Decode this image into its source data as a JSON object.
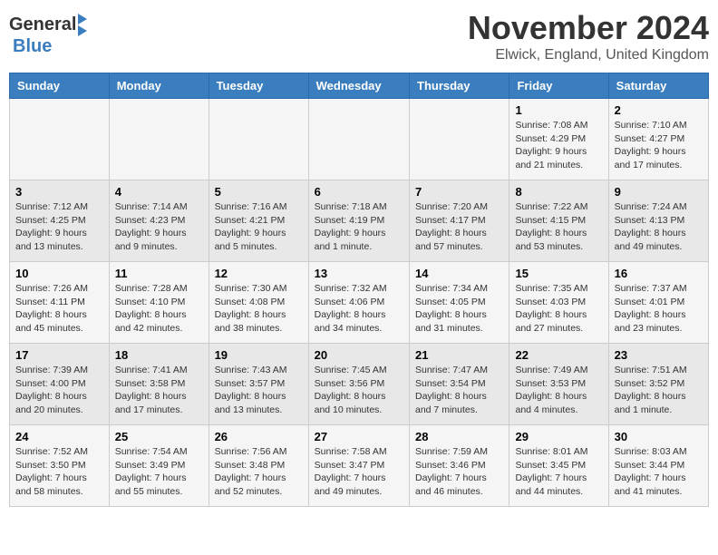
{
  "header": {
    "logo_general": "General",
    "logo_blue": "Blue",
    "month": "November 2024",
    "location": "Elwick, England, United Kingdom"
  },
  "days_of_week": [
    "Sunday",
    "Monday",
    "Tuesday",
    "Wednesday",
    "Thursday",
    "Friday",
    "Saturday"
  ],
  "weeks": [
    [
      {
        "day": "",
        "details": ""
      },
      {
        "day": "",
        "details": ""
      },
      {
        "day": "",
        "details": ""
      },
      {
        "day": "",
        "details": ""
      },
      {
        "day": "",
        "details": ""
      },
      {
        "day": "1",
        "details": "Sunrise: 7:08 AM\nSunset: 4:29 PM\nDaylight: 9 hours and 21 minutes."
      },
      {
        "day": "2",
        "details": "Sunrise: 7:10 AM\nSunset: 4:27 PM\nDaylight: 9 hours and 17 minutes."
      }
    ],
    [
      {
        "day": "3",
        "details": "Sunrise: 7:12 AM\nSunset: 4:25 PM\nDaylight: 9 hours and 13 minutes."
      },
      {
        "day": "4",
        "details": "Sunrise: 7:14 AM\nSunset: 4:23 PM\nDaylight: 9 hours and 9 minutes."
      },
      {
        "day": "5",
        "details": "Sunrise: 7:16 AM\nSunset: 4:21 PM\nDaylight: 9 hours and 5 minutes."
      },
      {
        "day": "6",
        "details": "Sunrise: 7:18 AM\nSunset: 4:19 PM\nDaylight: 9 hours and 1 minute."
      },
      {
        "day": "7",
        "details": "Sunrise: 7:20 AM\nSunset: 4:17 PM\nDaylight: 8 hours and 57 minutes."
      },
      {
        "day": "8",
        "details": "Sunrise: 7:22 AM\nSunset: 4:15 PM\nDaylight: 8 hours and 53 minutes."
      },
      {
        "day": "9",
        "details": "Sunrise: 7:24 AM\nSunset: 4:13 PM\nDaylight: 8 hours and 49 minutes."
      }
    ],
    [
      {
        "day": "10",
        "details": "Sunrise: 7:26 AM\nSunset: 4:11 PM\nDaylight: 8 hours and 45 minutes."
      },
      {
        "day": "11",
        "details": "Sunrise: 7:28 AM\nSunset: 4:10 PM\nDaylight: 8 hours and 42 minutes."
      },
      {
        "day": "12",
        "details": "Sunrise: 7:30 AM\nSunset: 4:08 PM\nDaylight: 8 hours and 38 minutes."
      },
      {
        "day": "13",
        "details": "Sunrise: 7:32 AM\nSunset: 4:06 PM\nDaylight: 8 hours and 34 minutes."
      },
      {
        "day": "14",
        "details": "Sunrise: 7:34 AM\nSunset: 4:05 PM\nDaylight: 8 hours and 31 minutes."
      },
      {
        "day": "15",
        "details": "Sunrise: 7:35 AM\nSunset: 4:03 PM\nDaylight: 8 hours and 27 minutes."
      },
      {
        "day": "16",
        "details": "Sunrise: 7:37 AM\nSunset: 4:01 PM\nDaylight: 8 hours and 23 minutes."
      }
    ],
    [
      {
        "day": "17",
        "details": "Sunrise: 7:39 AM\nSunset: 4:00 PM\nDaylight: 8 hours and 20 minutes."
      },
      {
        "day": "18",
        "details": "Sunrise: 7:41 AM\nSunset: 3:58 PM\nDaylight: 8 hours and 17 minutes."
      },
      {
        "day": "19",
        "details": "Sunrise: 7:43 AM\nSunset: 3:57 PM\nDaylight: 8 hours and 13 minutes."
      },
      {
        "day": "20",
        "details": "Sunrise: 7:45 AM\nSunset: 3:56 PM\nDaylight: 8 hours and 10 minutes."
      },
      {
        "day": "21",
        "details": "Sunrise: 7:47 AM\nSunset: 3:54 PM\nDaylight: 8 hours and 7 minutes."
      },
      {
        "day": "22",
        "details": "Sunrise: 7:49 AM\nSunset: 3:53 PM\nDaylight: 8 hours and 4 minutes."
      },
      {
        "day": "23",
        "details": "Sunrise: 7:51 AM\nSunset: 3:52 PM\nDaylight: 8 hours and 1 minute."
      }
    ],
    [
      {
        "day": "24",
        "details": "Sunrise: 7:52 AM\nSunset: 3:50 PM\nDaylight: 7 hours and 58 minutes."
      },
      {
        "day": "25",
        "details": "Sunrise: 7:54 AM\nSunset: 3:49 PM\nDaylight: 7 hours and 55 minutes."
      },
      {
        "day": "26",
        "details": "Sunrise: 7:56 AM\nSunset: 3:48 PM\nDaylight: 7 hours and 52 minutes."
      },
      {
        "day": "27",
        "details": "Sunrise: 7:58 AM\nSunset: 3:47 PM\nDaylight: 7 hours and 49 minutes."
      },
      {
        "day": "28",
        "details": "Sunrise: 7:59 AM\nSunset: 3:46 PM\nDaylight: 7 hours and 46 minutes."
      },
      {
        "day": "29",
        "details": "Sunrise: 8:01 AM\nSunset: 3:45 PM\nDaylight: 7 hours and 44 minutes."
      },
      {
        "day": "30",
        "details": "Sunrise: 8:03 AM\nSunset: 3:44 PM\nDaylight: 7 hours and 41 minutes."
      }
    ]
  ]
}
